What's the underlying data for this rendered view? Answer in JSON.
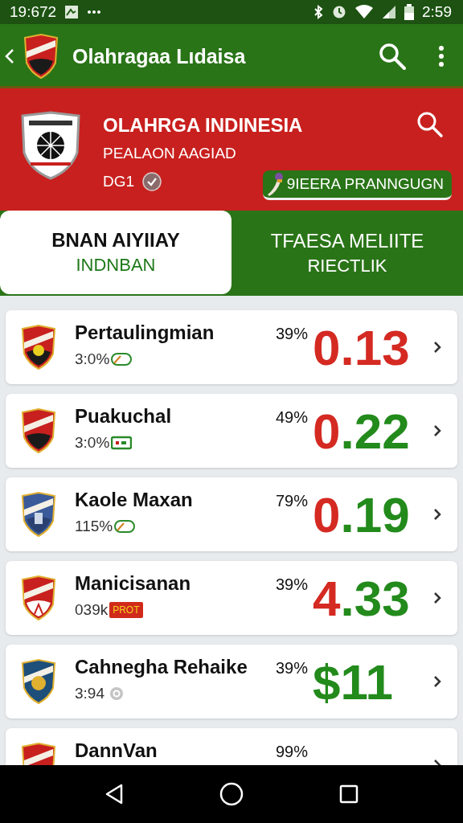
{
  "status_bar": {
    "time": "19:672",
    "clock": "2:59"
  },
  "app_bar": {
    "title": "Olahragaa Lıdaisa"
  },
  "header": {
    "title": "OLAHRGA INDINESIA",
    "subtitle": "PEALAON AAGIAD",
    "code": "DG1",
    "verified": true,
    "action": "9IEERA PRANNGUGN"
  },
  "tabs": [
    {
      "title": "BNAN AIYIIAY",
      "subtitle": "INDNBAN",
      "selected": true
    },
    {
      "title": "TFAESA MELIITE",
      "subtitle": "RIECTLIK",
      "selected": false
    }
  ],
  "rows": [
    {
      "name": "Pertaulingmian",
      "detail": "3:0%",
      "percent": "39%",
      "value": [
        {
          "text": "0.13",
          "color": "#d42a22"
        }
      ]
    },
    {
      "name": "Puakuchal",
      "detail": "3:0%",
      "percent": "49%",
      "value": [
        {
          "text": "0",
          "color": "#d42a22"
        },
        {
          "text": ".22",
          "color": "#238a1c"
        }
      ]
    },
    {
      "name": "Kaole Maxan",
      "detail": "115%",
      "percent": "79%",
      "value": [
        {
          "text": "0",
          "color": "#d42a22"
        },
        {
          "text": ".19",
          "color": "#238a1c"
        }
      ]
    },
    {
      "name": "Manicisanan",
      "detail": "039k",
      "tag": "PROT",
      "percent": "39%",
      "value": [
        {
          "text": "4",
          "color": "#d42a22"
        },
        {
          "text": ".33",
          "color": "#238a1c"
        }
      ]
    },
    {
      "name": "Cahnegha Rehaike",
      "detail": "3:94",
      "percent": "39%",
      "value": [
        {
          "text": "$11",
          "color": "#238a1c"
        }
      ]
    },
    {
      "name": "DannVan",
      "percent": "99%"
    }
  ]
}
